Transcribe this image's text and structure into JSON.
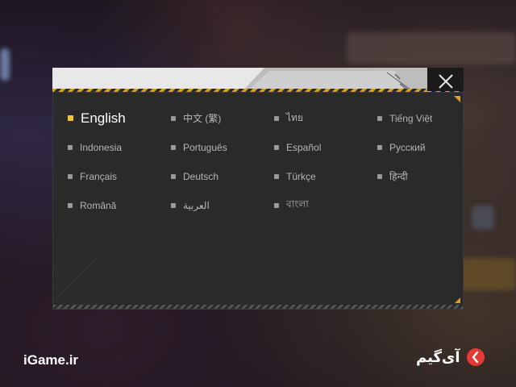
{
  "dialog": {
    "close_icon": "close-icon",
    "accent_color": "#f1c232",
    "languages": [
      {
        "label": "English",
        "selected": true
      },
      {
        "label": "中文 (繁)",
        "selected": false
      },
      {
        "label": "ไทย",
        "selected": false
      },
      {
        "label": "Tiếng Việt",
        "selected": false
      },
      {
        "label": "Indonesia",
        "selected": false
      },
      {
        "label": "Português",
        "selected": false
      },
      {
        "label": "Español",
        "selected": false
      },
      {
        "label": "Русский",
        "selected": false
      },
      {
        "label": "Français",
        "selected": false
      },
      {
        "label": "Deutsch",
        "selected": false
      },
      {
        "label": "Türkçe",
        "selected": false
      },
      {
        "label": "हिन्दी",
        "selected": false
      },
      {
        "label": "Română",
        "selected": false
      },
      {
        "label": "العربية",
        "selected": false
      },
      {
        "label": "বাংলা",
        "selected": false
      }
    ]
  },
  "watermark": {
    "left_text": "iGame.ir",
    "right_text": "آی‌گیم"
  }
}
